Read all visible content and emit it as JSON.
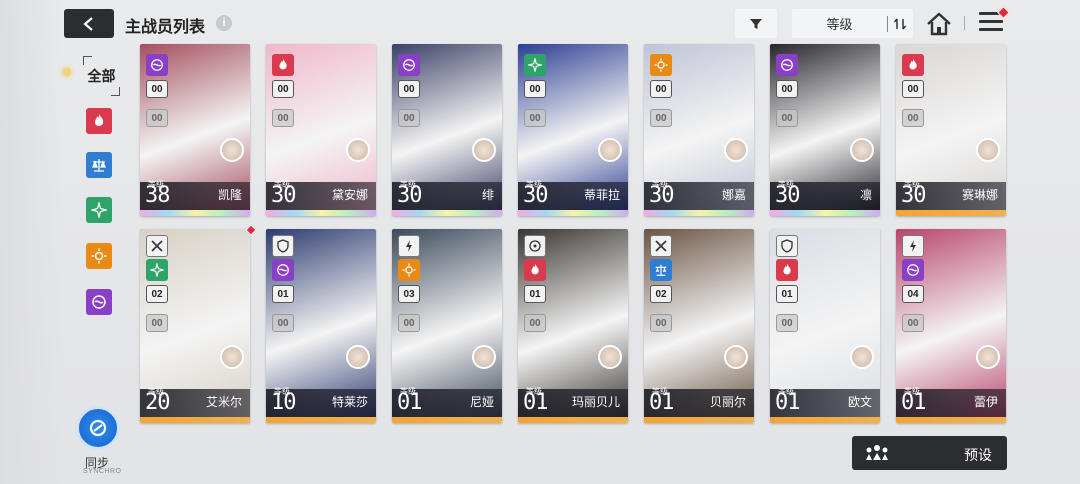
{
  "header": {
    "title": "主战员列表",
    "info_icon": "info-icon",
    "sort_label": "等级"
  },
  "filters": {
    "all_label": "全部",
    "elements": [
      {
        "name": "fire",
        "color": "#d93a4d"
      },
      {
        "name": "water",
        "color": "#2f7ed1"
      },
      {
        "name": "wind",
        "color": "#2ea36a"
      },
      {
        "name": "electric",
        "color": "#e88a15"
      },
      {
        "name": "iron",
        "color": "#8a3fc7"
      }
    ]
  },
  "sync": {
    "label": "同步",
    "sub": "SYNCHRO"
  },
  "preset": {
    "label": "预设"
  },
  "level_label": "等级",
  "cards": [
    {
      "name": "凯隆",
      "level": "38",
      "rank": "00",
      "rank2": "00",
      "element": "iron",
      "art": "#a44f5e",
      "bottom": "holo"
    },
    {
      "name": "黛安娜",
      "level": "30",
      "rank": "00",
      "rank2": "00",
      "element": "fire",
      "art": "#f0b7c9",
      "bottom": "holo"
    },
    {
      "name": "绯",
      "level": "30",
      "rank": "00",
      "rank2": "00",
      "element": "iron",
      "art": "#3c4166",
      "bottom": "holo"
    },
    {
      "name": "蒂菲拉",
      "level": "30",
      "rank": "00",
      "rank2": "00",
      "element": "wind",
      "art": "#2c3f93",
      "bottom": "holo"
    },
    {
      "name": "娜嘉",
      "level": "30",
      "rank": "00",
      "rank2": "00",
      "element": "electric",
      "art": "#bfc4d6",
      "bottom": "holo"
    },
    {
      "name": "凛",
      "level": "30",
      "rank": "00",
      "rank2": "00",
      "element": "iron",
      "art": "#26262c",
      "bottom": "holo"
    },
    {
      "name": "赛琳娜",
      "level": "30",
      "rank": "00",
      "rank2": "00",
      "element": "fire",
      "art": "#d9d6d4",
      "bottom": "orange"
    },
    {
      "name": "艾米尔",
      "level": "20",
      "rank": "02",
      "rank2": "00",
      "element": "wind",
      "art": "#d7d0c4",
      "bottom": "orange"
    },
    {
      "name": "特莱莎",
      "level": "10",
      "rank": "01",
      "rank2": "00",
      "element": "iron",
      "art": "#2d3b70",
      "bottom": "orange"
    },
    {
      "name": "尼娅",
      "level": "01",
      "rank": "03",
      "rank2": "00",
      "element": "electric",
      "art": "#3d4a5c",
      "bottom": "orange"
    },
    {
      "name": "玛丽贝儿",
      "level": "01",
      "rank": "01",
      "rank2": "00",
      "element": "fire",
      "art": "#3a3632",
      "bottom": "orange"
    },
    {
      "name": "贝丽尔",
      "level": "01",
      "rank": "02",
      "rank2": "00",
      "element": "water",
      "art": "#6b5545",
      "bottom": "orange"
    },
    {
      "name": "欧文",
      "level": "01",
      "rank": "01",
      "rank2": "00",
      "element": "fire",
      "art": "#d9dde4",
      "bottom": "orange"
    },
    {
      "name": "蕾伊",
      "level": "01",
      "rank": "04",
      "rank2": "00",
      "element": "iron",
      "art": "#b8456a",
      "bottom": "orange"
    }
  ]
}
